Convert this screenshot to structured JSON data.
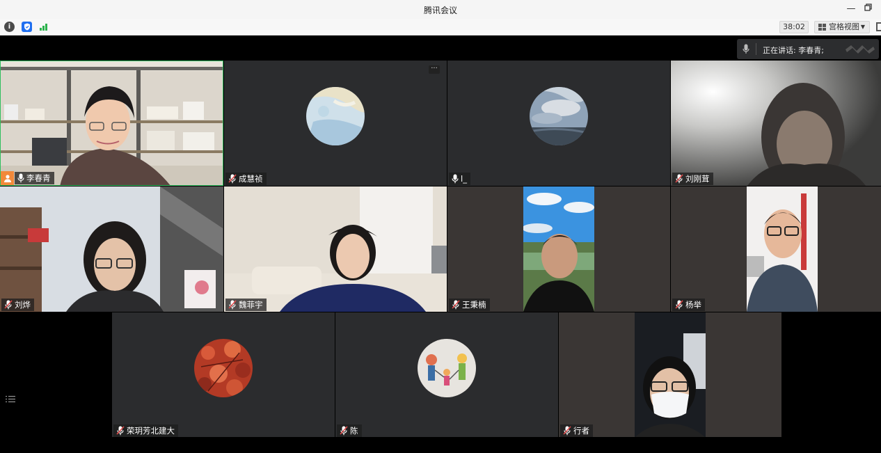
{
  "window": {
    "title": "腾讯会议"
  },
  "toolbar": {
    "timer": "38:02",
    "view_label": "宫格视图",
    "icons": [
      "info-icon",
      "shield-icon",
      "signal-icon",
      "grid-icon",
      "fullscreen-icon"
    ]
  },
  "speaking": {
    "label": "正在讲话: 李春青;"
  },
  "participants": [
    {
      "name": "李春青",
      "mic": "on",
      "video": true,
      "host": true,
      "active": true
    },
    {
      "name": "成慧祯",
      "mic": "muted",
      "video": false
    },
    {
      "name": "l_",
      "mic": "on",
      "video": false
    },
    {
      "name": "刘刚茸",
      "mic": "muted",
      "video": true
    },
    {
      "name": "刘烨",
      "mic": "muted",
      "video": true
    },
    {
      "name": "魏菲宇",
      "mic": "muted",
      "video": true
    },
    {
      "name": "王秉楠",
      "mic": "muted",
      "video": true
    },
    {
      "name": "杨举",
      "mic": "muted",
      "video": true
    },
    {
      "name": "荣玥芳北建大",
      "mic": "muted",
      "video": false
    },
    {
      "name": "陈",
      "mic": "muted",
      "video": false
    },
    {
      "name": "行者",
      "mic": "muted",
      "video": true
    }
  ],
  "colors": {
    "active_border": "#2fbf5e",
    "host_badge": "#f2893a",
    "muted_mic": "#e04b4b",
    "tile_bg": "#2b2c2e"
  }
}
